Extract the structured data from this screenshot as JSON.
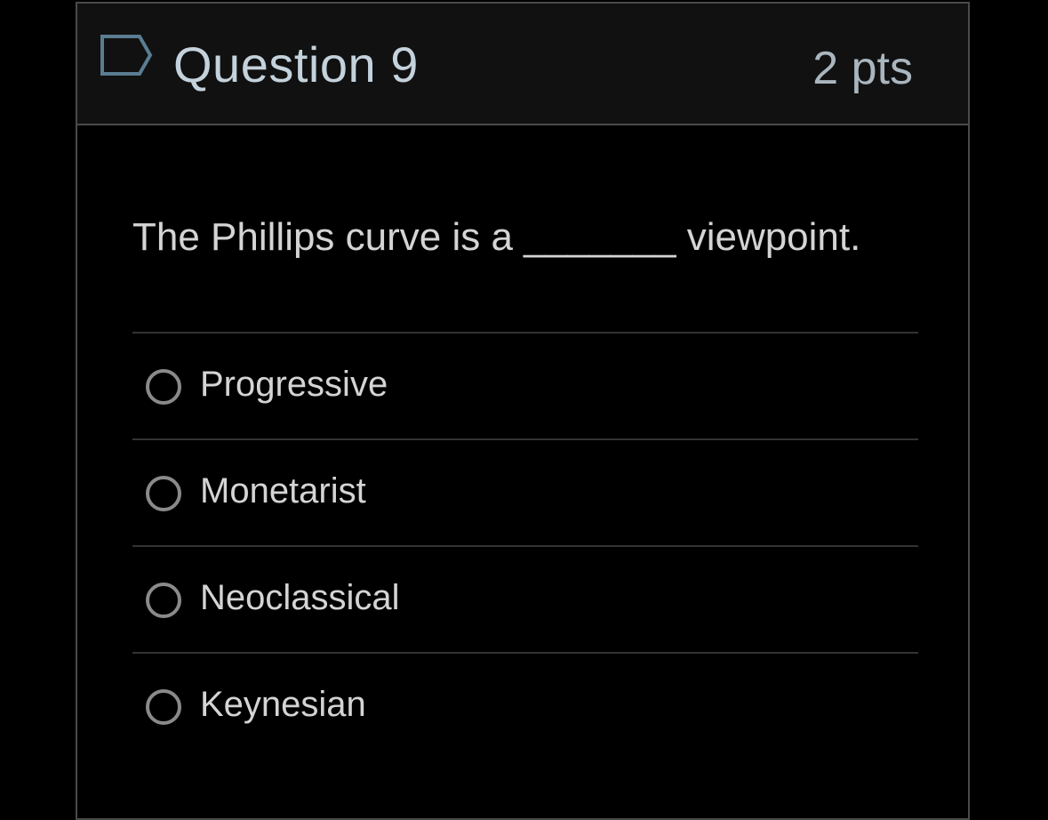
{
  "question": {
    "flag_icon": "flag-outline-icon",
    "title": "Question 9",
    "points": "2 pts",
    "text": "The Phillips curve is a _______ viewpoint."
  },
  "answers": [
    {
      "label": "Progressive",
      "selected": false
    },
    {
      "label": "Monetarist",
      "selected": false
    },
    {
      "label": "Neoclassical",
      "selected": false
    },
    {
      "label": "Keynesian",
      "selected": false
    }
  ],
  "colors": {
    "background": "#000000",
    "header_bg": "#111111",
    "border": "#4a4a4a",
    "title_text": "#c4d2dc",
    "flag_stroke": "#5a7d92",
    "body_text": "#d4d4d4",
    "radio_border": "#8a8a8a",
    "divider": "#333333"
  }
}
